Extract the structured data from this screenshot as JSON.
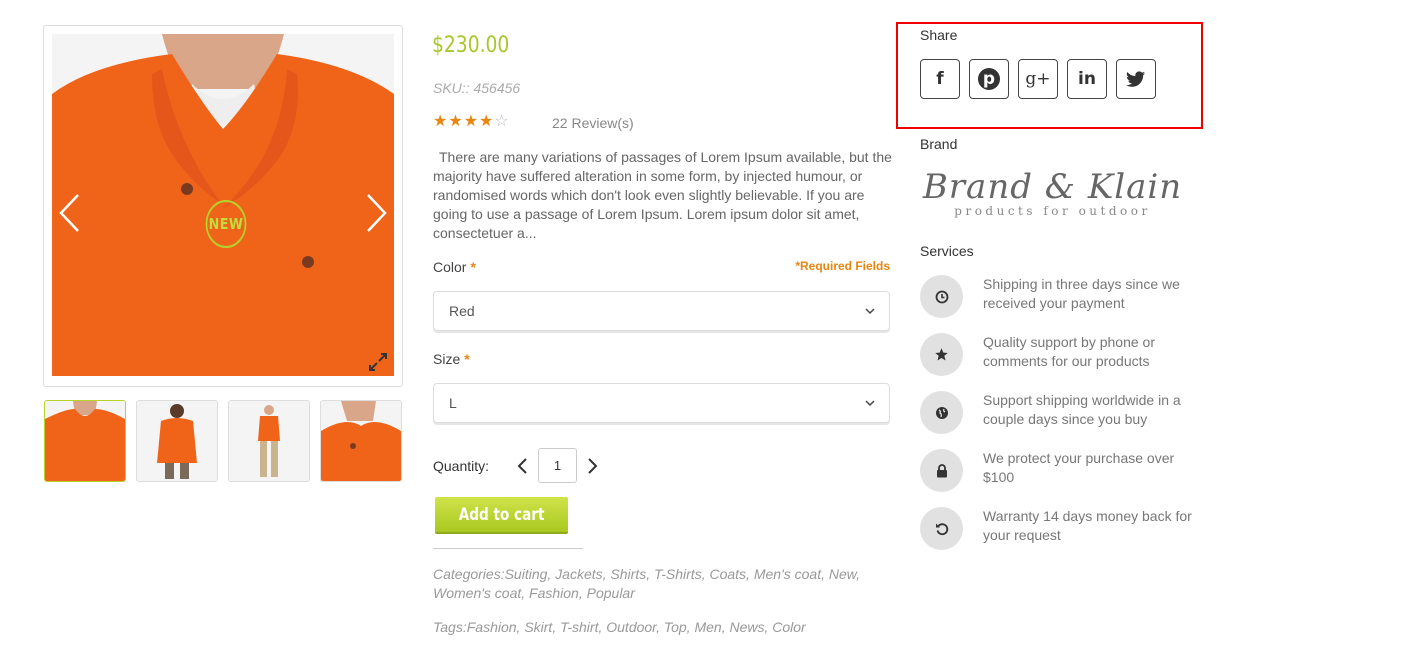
{
  "gallery": {
    "badge": "NEW",
    "icons": {
      "prev": "chevron-left-icon",
      "next": "chevron-right-icon",
      "zoom": "expand-icon"
    }
  },
  "product": {
    "price": "$230.00",
    "sku": "SKU:: 456456",
    "rating": 4,
    "rating_max": 5,
    "reviews": "22 Review(s)",
    "description": "There are many variations of passages of Lorem Ipsum available, but the majority have suffered alteration in some form, by injected humour, or randomised words which don't look even slightly believable. If you are going to use a passage of Lorem Ipsum. Lorem ipsum dolor sit amet, consectetuer a...",
    "color_label": "Color",
    "required_mark": "*",
    "required_note": "*Required Fields",
    "color_value": "Red",
    "size_label": "Size",
    "size_value": "L",
    "quantity_label": "Quantity:",
    "quantity_value": "1",
    "add_to_cart": "Add to cart",
    "categories": "Categories:Suiting, Jackets, Shirts, T-Shirts, Coats, Men's coat, New, Women's coat, Fashion, Popular",
    "tags": "Tags:Fashion, Skirt, T-shirt, Outdoor, Top, Men, News, Color"
  },
  "sidebar": {
    "share_title": "Share",
    "social": [
      "facebook-icon",
      "pinterest-icon",
      "google-plus-icon",
      "linkedin-icon",
      "twitter-icon"
    ],
    "social_glyphs": {
      "facebook": "f",
      "pinterest": "p",
      "google": "g+",
      "linkedin": "in"
    },
    "brand_title": "Brand",
    "brand_logo_name": "Brand & Klain",
    "brand_logo_tagline": "products for outdoor",
    "services_title": "Services",
    "services": [
      {
        "icon": "clock-icon",
        "text": "Shipping in three days since we received your payment"
      },
      {
        "icon": "star-icon",
        "text": "Quality support by phone or comments for our products"
      },
      {
        "icon": "globe-icon",
        "text": "Support shipping worldwide in a couple days since you buy"
      },
      {
        "icon": "lock-icon",
        "text": "We protect your purchase over $100"
      },
      {
        "icon": "undo-icon",
        "text": "Warranty 14 days money back for your request"
      }
    ]
  },
  "colors": {
    "accent_green": "#a6c828",
    "accent_orange": "#e8860f",
    "highlight_border": "#e00000",
    "sweater": "#f0641a"
  }
}
